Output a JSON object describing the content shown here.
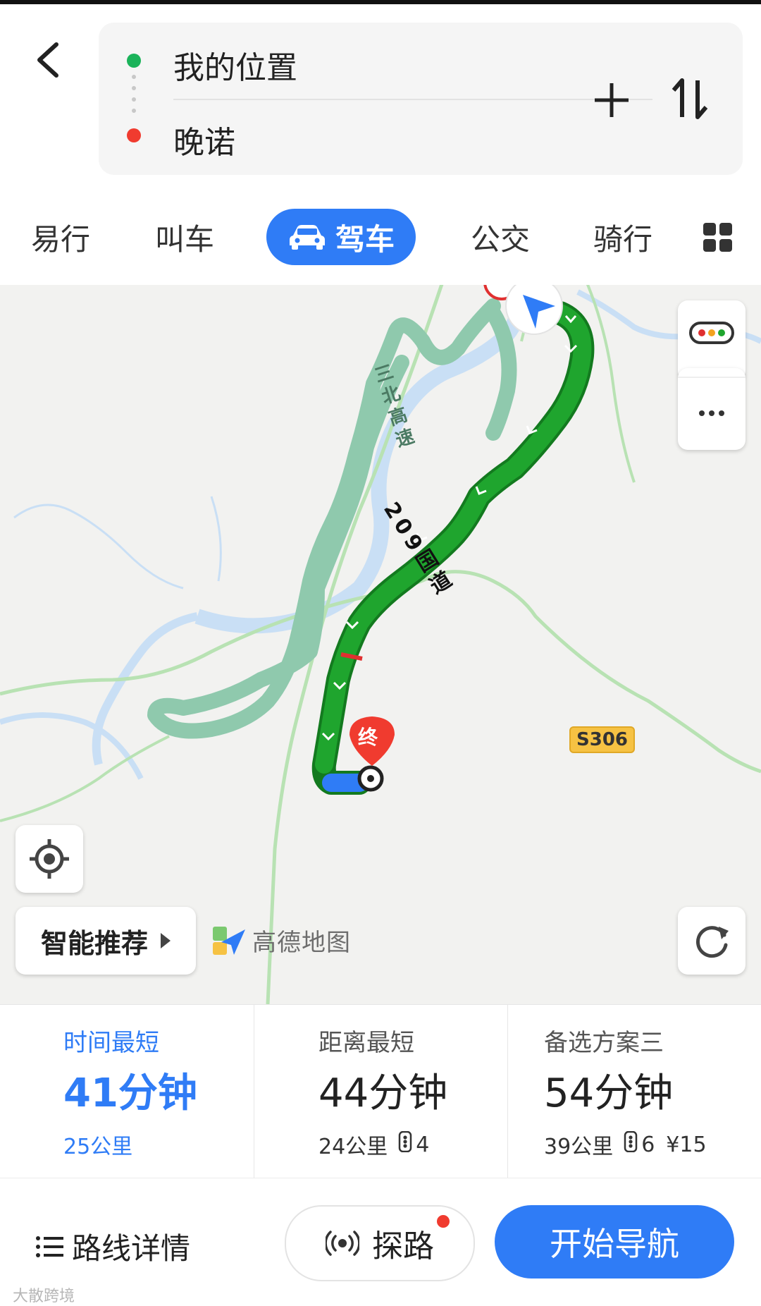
{
  "header": {
    "from": "我的位置",
    "to": "晚诺"
  },
  "tabs": [
    {
      "label": "易行"
    },
    {
      "label": "叫车"
    },
    {
      "label": "驾车",
      "active": true
    },
    {
      "label": "公交"
    },
    {
      "label": "骑行"
    }
  ],
  "map": {
    "road_labels": {
      "expressway_name": "三北高速",
      "national_road": "209国道",
      "provincial_road": "S306"
    },
    "end_marker": "终",
    "logo_text": "高德地图",
    "smart_recommend": "智能推荐",
    "colors": {
      "route_main": "#1fa52e",
      "route_alt": "#7fc5a3",
      "congestion": "#e03030",
      "slow_blue": "#2f7cf6"
    }
  },
  "route_options": [
    {
      "title": "时间最短",
      "time": "41分钟",
      "distance": "25公里",
      "active": true
    },
    {
      "title": "距离最短",
      "time": "44分钟",
      "distance": "24公里",
      "lights": "4"
    },
    {
      "title": "备选方案三",
      "time": "54分钟",
      "distance": "39公里",
      "lights": "6",
      "toll": "¥15"
    }
  ],
  "bottom": {
    "route_detail": "路线详情",
    "explore": "探路",
    "start_nav": "开始导航"
  },
  "watermark": "大散跨境"
}
